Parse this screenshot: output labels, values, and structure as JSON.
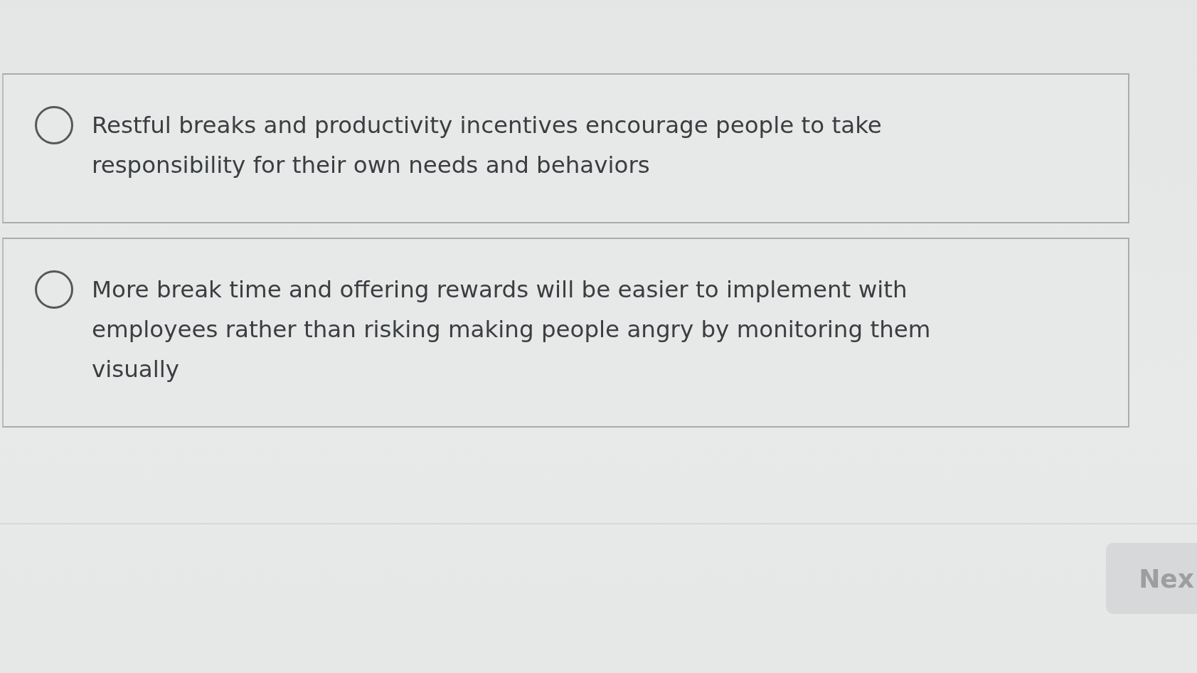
{
  "options": [
    {
      "text": "Restful breaks and productivity incentives encourage people to take responsibility for their own needs and behaviors",
      "selected": false
    },
    {
      "text": "More break time and offering rewards will be easier to implement with employees rather than risking making people angry by monitoring them visually",
      "selected": false
    }
  ],
  "next_button": {
    "label": "Nex",
    "disabled": true
  }
}
